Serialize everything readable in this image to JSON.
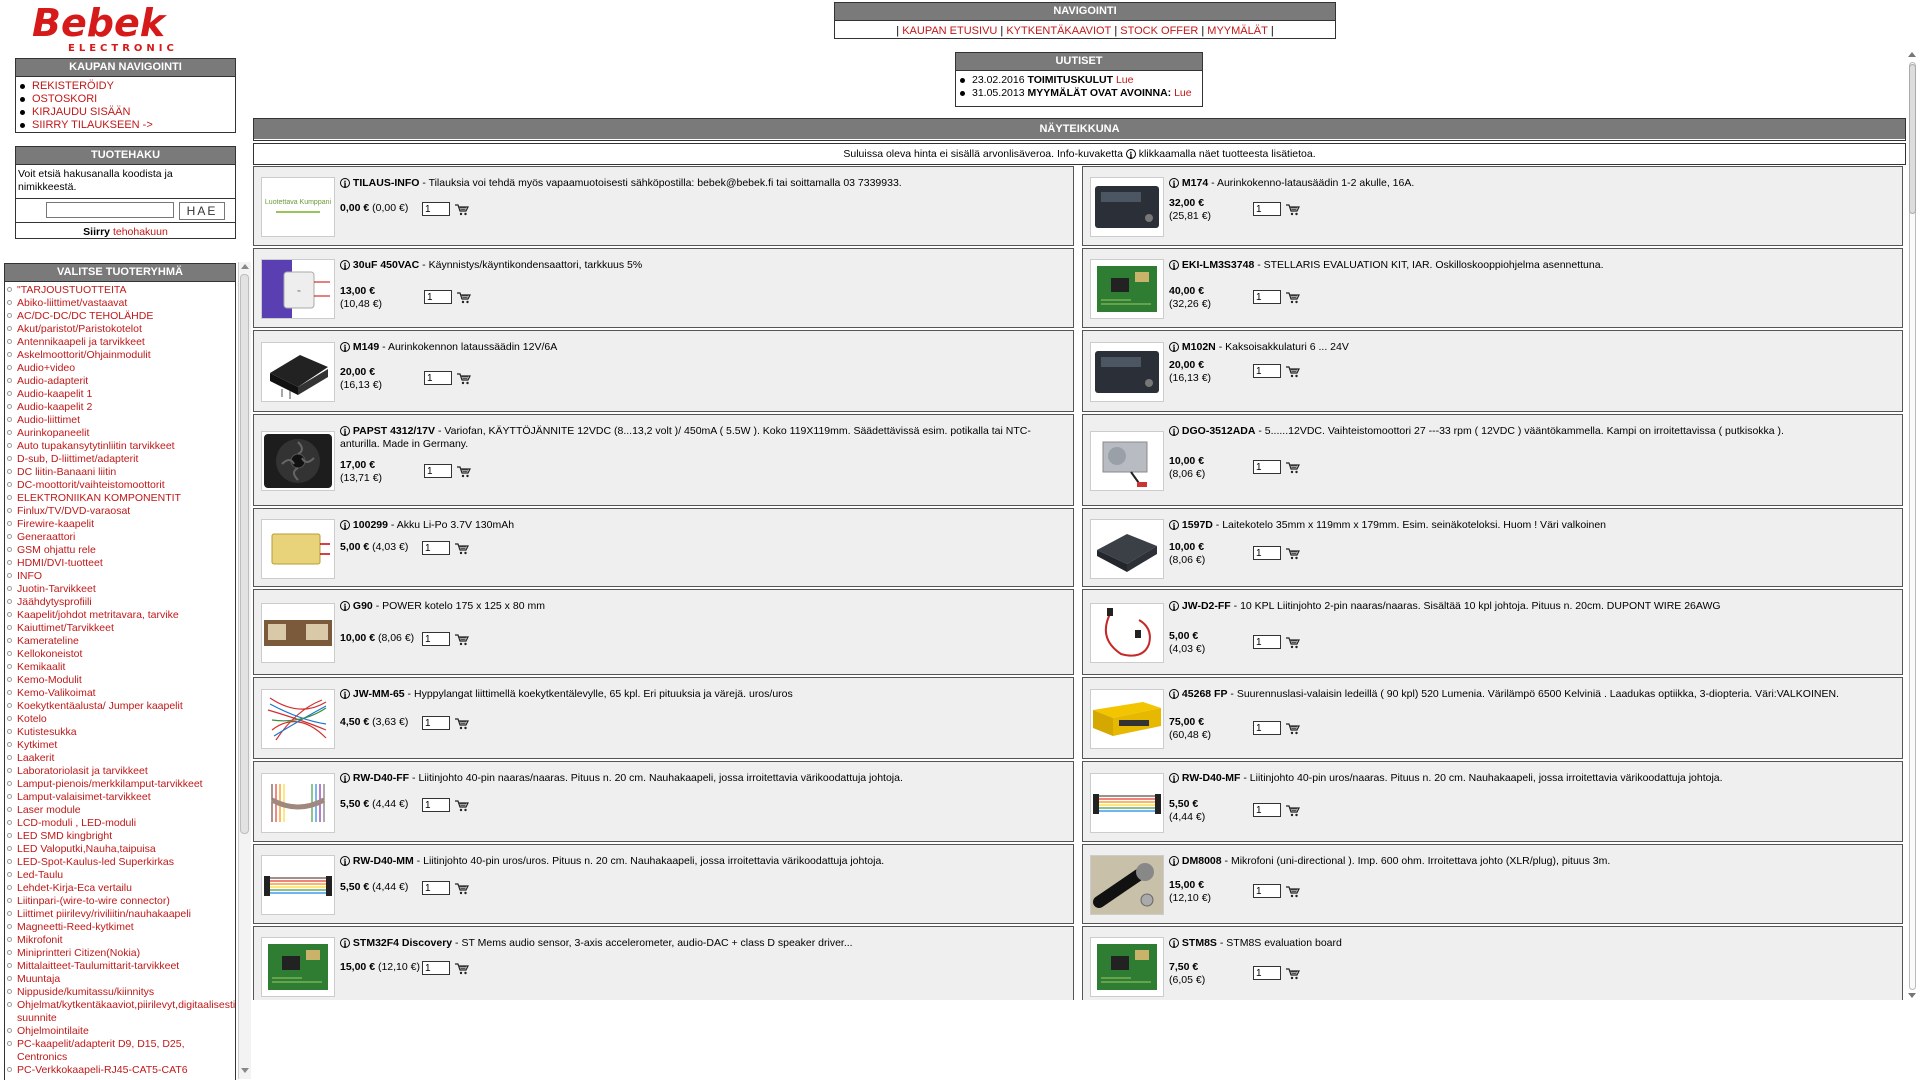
{
  "logo": {
    "brand": "Bebek",
    "sub": "ELECTRONIC"
  },
  "colors": {
    "header_bar": "#7a7a7a",
    "link": "#c01818",
    "cell_bg": "#efefef"
  },
  "topnav": {
    "title": "NAVIGOINTI",
    "links": [
      "KAUPAN ETUSIVU",
      "KYTKENTÄKAAVIOT",
      "STOCK OFFER",
      "MYYMÄLÄT"
    ]
  },
  "news": {
    "title": "UUTISET",
    "items": [
      {
        "date": "23.02.2016",
        "title": "TOIMITUSKULUT",
        "link": "Lue"
      },
      {
        "date": "31.05.2013",
        "title": "MYYMÄLÄT OVAT AVOINNA:",
        "link": "Lue"
      }
    ]
  },
  "shopnav": {
    "title": "KAUPAN NAVIGOINTI",
    "items": [
      "REKISTERÖIDY",
      "OSTOSKORI",
      "KIRJAUDU SISÄÄN",
      "SIIRRY TILAUKSEEN ->"
    ]
  },
  "search": {
    "title": "TUOTEHAKU",
    "description": "Voit etsiä hakusanalla koodista ja nimikkeestä.",
    "value": "",
    "button": "HAE",
    "adv_prefix": "Siirry",
    "adv_link": "tehohakuun"
  },
  "groups": {
    "title": "VALITSE TUOTERYHMÄ",
    "items": [
      "\"TARJOUSTUOTTEITA",
      "Abiko-liittimet/vastaavat",
      "AC/DC-DC/DC TEHOLÄHDE",
      "Akut/paristot/Paristokotelot",
      "Antennikaapeli ja tarvikkeet",
      "Askelmoottorit/Ohjainmodulit",
      "Audio+video",
      "Audio-adapterit",
      "Audio-kaapelit 1",
      "Audio-kaapelit 2",
      "Audio-liittimet",
      "Aurinkopaneelit",
      "Auto tupakansytytinliitin tarvikkeet",
      "D-sub, D-liittimet/adapterit",
      "DC liitin-Banaani liitin",
      "DC-moottorit/vaihteistomoottorit",
      "ELEKTRONIIKAN KOMPONENTIT",
      "Finlux/TV/DVD-varaosat",
      "Firewire-kaapelit",
      "Generaattori",
      "GSM ohjattu rele",
      "HDMI/DVI-tuotteet",
      "INFO",
      "Juotin-Tarvikkeet",
      "Jäähdytysprofiili",
      "Kaapelit/johdot metritavara, tarvike",
      "Kaiuttimet/Tarvikkeet",
      "Kamerateline",
      "Kellokoneistot",
      "Kemikaalit",
      "Kemo-Modulit",
      "Kemo-Valikoimat",
      "Koekytkentäalusta/ Jumper kaapelit",
      "Kotelo",
      "Kutistesukka",
      "Kytkimet",
      "Laakerit",
      "Laboratoriolasit ja tarvikkeet",
      "Lamput-pienois/merkkilamput-tarvikkeet",
      "Lamput-valaisimet-tarvikkeet",
      "Laser module",
      "LCD-moduli , LED-moduli",
      "LED SMD kingbright",
      "LED Valoputki,Nauha,taipuisa",
      "LED-Spot-Kaulus-led Superkirkas",
      "Led-Taulu",
      "Lehdet-Kirja-Eca vertailu",
      "Liitinpari-(wire-to-wire connector)",
      "Liittimet piirilevy/riviliitin/nauhakaapeli",
      "Magneetti-Reed-kytkimet",
      "Mikrofonit",
      "Miniprintteri Citizen(Nokia)",
      "Mittalaitteet-Taulumittarit-tarvikkeet",
      "Muuntaja",
      "Nippuside/kumitassu/kiinnitys",
      "Ohjelmat/kytkentäkaaviot,piirilevyt,digitaalisesti suunnite",
      "Ohjelmointilaite",
      "PC-kaapelit/adapterit D9, D15, D25, Centronics",
      "PC-Verkkokaapeli-RJ45-CAT5-CAT6"
    ]
  },
  "main": {
    "title": "NÄYTEIKKUNA",
    "info_before": "Suluissa oleva hinta ei sisällä arvonlisäveroa. Info-kuvaketta",
    "info_after": "klikkaamalla näet tuotteesta lisätietoa.",
    "qty_default": "1"
  },
  "products": [
    {
      "code": "TILAUS-INFO",
      "desc": "Tilauksia voi tehdä myös vapaamuotoisesti sähköpostilla: bebek@bebek.fi tai soittamalla 03 7339933.",
      "price": "0,00 €",
      "net": "(0,00 €)",
      "thumb": "partner",
      "thumb_label": "Luotettava Kumppani"
    },
    {
      "code": "M174",
      "desc": "Aurinkokenno-latausäädin 1-2 akulle, 16A.",
      "price": "32,00 €",
      "net": "(25,81 €)",
      "thumb": "dark-box",
      "thumb_label": ""
    },
    {
      "code": "30uF 450VAC",
      "desc": "Käynnistys/käyntikondensaattori, tarkkuus 5%",
      "price": "13,00 €",
      "net": "(10,48 €)",
      "thumb": "capacitor",
      "thumb_label": ""
    },
    {
      "code": "EKI-LM3S3748",
      "desc": "STELLARIS EVALUATION KIT, IAR. Oskilloskooppiohjelma asennettuna.",
      "price": "40,00 €",
      "net": "(32,26 €)",
      "thumb": "pcb-green",
      "thumb_label": ""
    },
    {
      "code": "M149",
      "desc": "Aurinkokennon lataussäädin 12V/6A",
      "price": "20,00 €",
      "net": "(16,13 €)",
      "thumb": "module-black",
      "thumb_label": ""
    },
    {
      "code": "M102N",
      "desc": "Kaksoisakkulaturi 6 ... 24V",
      "price": "20,00 €",
      "net": "(16,13 €)",
      "thumb": "dark-box",
      "thumb_label": ""
    },
    {
      "code": "PAPST 4312/17V",
      "desc": "Variofan, KÄYTTÖJÄNNITE 12VDC (8...13,2 volt )/ 450mA ( 5.5W ). Koko 119X119mm. Säädettävissä esim. potikalla tai NTC-anturilla. Made in Germany.",
      "price": "17,00 €",
      "net": "(13,71 €)",
      "thumb": "fan",
      "thumb_label": ""
    },
    {
      "code": "DGO-3512ADA",
      "desc": "5......12VDC. Vaihteistomoottori 27 ---33 rpm ( 12VDC ) vääntökammella. Kampi on irroitettavissa ( putkisokka ).",
      "price": "10,00 €",
      "net": "(8,06 €)",
      "thumb": "motor",
      "thumb_label": ""
    },
    {
      "code": "100299",
      "desc": "Akku Li-Po 3.7V 130mAh",
      "price": "5,00 €",
      "net": "(4,03 €)",
      "thumb": "battery",
      "thumb_label": ""
    },
    {
      "code": "1597D",
      "desc": "Laitekotelo 35mm x 119mm x 179mm. Esim. seinäkoteloksi. Huom ! Väri valkoinen",
      "price": "10,00 €",
      "net": "(8,06 €)",
      "thumb": "enclosure",
      "thumb_label": ""
    },
    {
      "code": "G90",
      "desc": "POWER kotelo 175 x 125 x 80 mm",
      "price": "10,00 €",
      "net": "(8,06 €)",
      "thumb": "case-brown",
      "thumb_label": ""
    },
    {
      "code": "JW-D2-FF",
      "desc": "10 KPL Liitinjohto 2-pin naaras/naaras. Sisältää 10 kpl johtoja. Pituus n. 20cm. DUPONT WIRE 26AWG",
      "price": "5,00 €",
      "net": "(4,03 €)",
      "thumb": "wire-red",
      "thumb_label": ""
    },
    {
      "code": "JW-MM-65",
      "desc": "Hyppylangat liittimellä koekytkentälevylle, 65 kpl. Eri pituuksia ja värejä. uros/uros",
      "price": "4,50 €",
      "net": "(3,63 €)",
      "thumb": "jumpers",
      "thumb_label": ""
    },
    {
      "code": "45268 FP",
      "desc": "Suurennuslasi-valaisin ledeillä ( 90 kpl) 520 Lumenia. Värilämpö 6500 Kelviniä . Laadukas optiikka, 3-diopteria. Väri:VALKOINEN.",
      "price": "75,00 €",
      "net": "(60,48 €)",
      "thumb": "box-yellow",
      "thumb_label": ""
    },
    {
      "code": "RW-D40-FF",
      "desc": "Liitinjohto 40-pin naaras/naaras. Pituus n. 20 cm. Nauhakaapeli, jossa irroitettavia värikoodattuja johtoja.",
      "price": "5,50 €",
      "net": "(4,44 €)",
      "thumb": "ribbon-v",
      "thumb_label": ""
    },
    {
      "code": "RW-D40-MF",
      "desc": "Liitinjohto 40-pin uros/naaras. Pituus n. 20 cm. Nauhakaapeli, jossa irroitettavia värikoodattuja johtoja.",
      "price": "5,50 €",
      "net": "(4,44 €)",
      "thumb": "ribbon-h",
      "thumb_label": ""
    },
    {
      "code": "RW-D40-MM",
      "desc": "Liitinjohto 40-pin uros/uros. Pituus n. 20 cm. Nauhakaapeli, jossa irroitettavia värikoodattuja johtoja.",
      "price": "5,50 €",
      "net": "(4,44 €)",
      "thumb": "ribbon-h",
      "thumb_label": ""
    },
    {
      "code": "DM8008",
      "desc": "Mikrofoni (uni-directional ). Imp. 600 ohm. Irroitettava johto (XLR/plug), pituus 3m.",
      "price": "15,00 €",
      "net": "(12,10 €)",
      "thumb": "mic",
      "thumb_label": ""
    },
    {
      "code": "STM32F4 Discovery",
      "desc": "ST Mems audio sensor, 3-axis accelerometer, audio-DAC + class D speaker driver...",
      "price": "15,00 €",
      "net": "(12,10 €)",
      "thumb": "pcb-green",
      "thumb_label": ""
    },
    {
      "code": "STM8S",
      "desc": "STM8S evaluation board",
      "price": "7,50 €",
      "net": "(6,05 €)",
      "thumb": "pcb-green",
      "thumb_label": ""
    }
  ]
}
